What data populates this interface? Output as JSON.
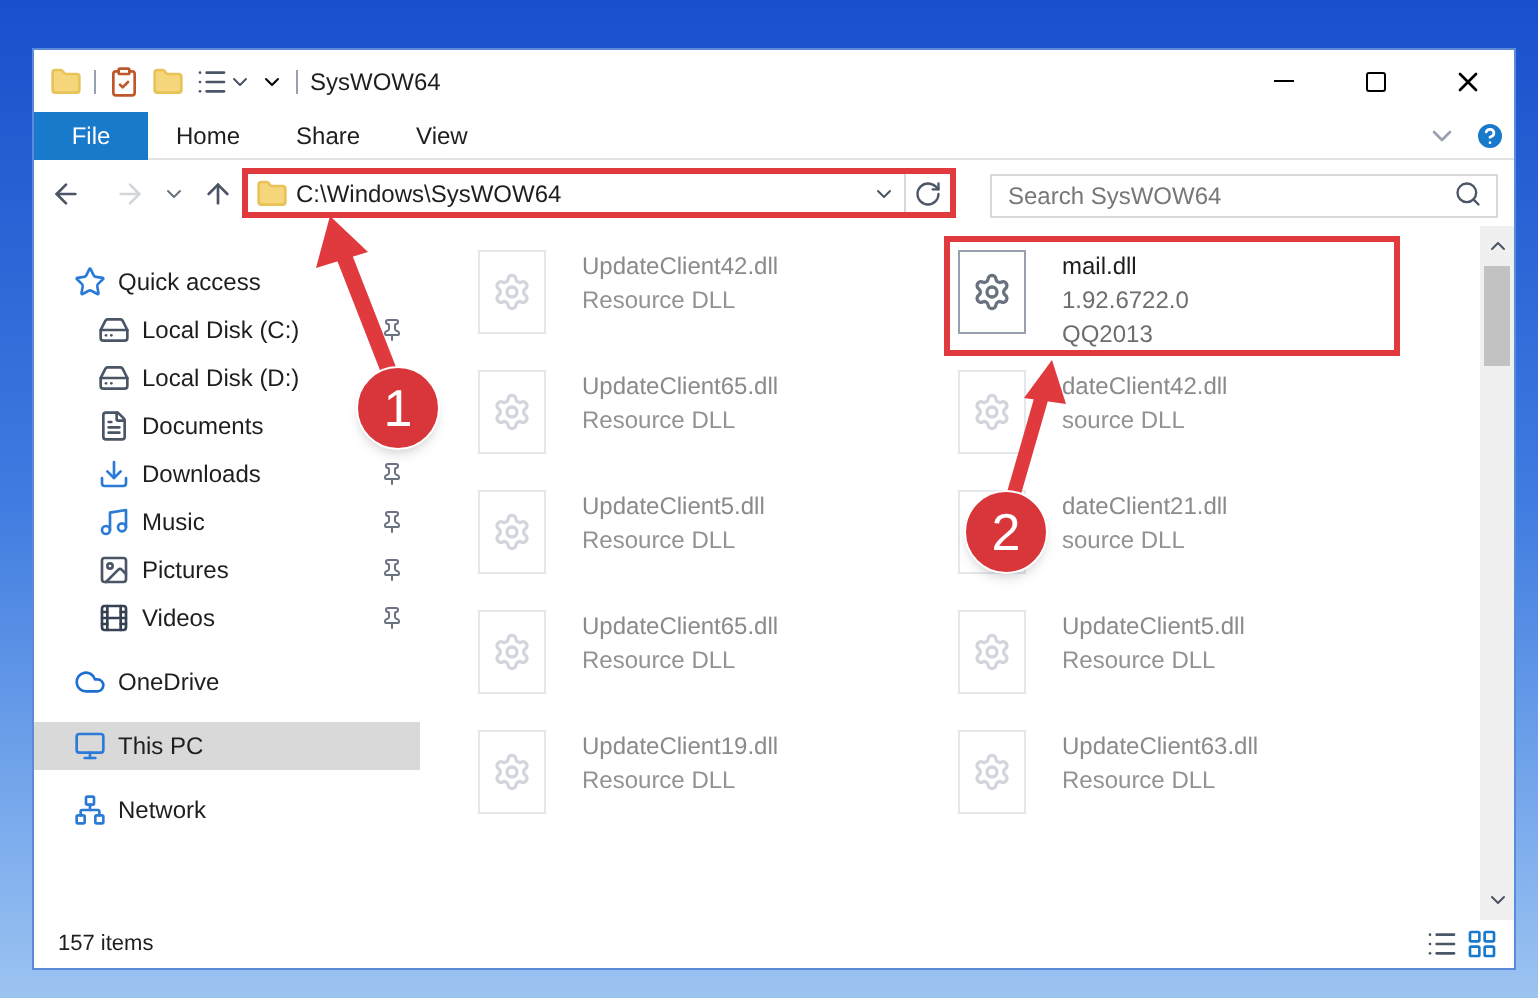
{
  "window": {
    "title": "SysWOW64"
  },
  "ribbon_tabs": [
    {
      "label": "File",
      "kind": "file"
    },
    {
      "label": "Home",
      "kind": "tab"
    },
    {
      "label": "Share",
      "kind": "tab"
    },
    {
      "label": "View",
      "kind": "tab"
    }
  ],
  "address": {
    "path": "C:\\Windows\\SysWOW64",
    "highlighted": true
  },
  "search": {
    "placeholder": "Search SysWOW64"
  },
  "sidebar": {
    "items": [
      {
        "label": "Quick access",
        "kind": "star",
        "selected": false,
        "children": [
          {
            "label": "Local Disk (C:)",
            "kind": "disk",
            "pinned": true,
            "selected": false
          },
          {
            "label": "Local Disk (D:)",
            "kind": "disk",
            "pinned": false,
            "selected": false
          },
          {
            "label": "Documents",
            "kind": "document",
            "pinned": false,
            "selected": false
          },
          {
            "label": "Downloads",
            "kind": "download",
            "pinned": true,
            "selected": false
          },
          {
            "label": "Music",
            "kind": "music",
            "pinned": true,
            "selected": false
          },
          {
            "label": "Pictures",
            "kind": "pictures",
            "pinned": true,
            "selected": false
          },
          {
            "label": "Videos",
            "kind": "videos",
            "pinned": true,
            "selected": false
          }
        ]
      },
      {
        "label": "OneDrive",
        "kind": "cloud",
        "selected": false
      },
      {
        "label": "This PC",
        "kind": "pc",
        "selected": true
      },
      {
        "label": "Network",
        "kind": "network",
        "selected": false
      }
    ]
  },
  "files": [
    {
      "name": "UpdateClient42.dll",
      "details": [
        "Resource DLL"
      ],
      "blurred": true,
      "highlighted": false
    },
    {
      "name": "mail.dll",
      "details": [
        "1.92.6722.0",
        "QQ2013"
      ],
      "blurred": false,
      "highlighted": true
    },
    {
      "name": "UpdateClient65.dll",
      "details": [
        "Resource DLL"
      ],
      "blurred": true,
      "highlighted": false
    },
    {
      "name": "dateClient42.dll",
      "details": [
        "source DLL"
      ],
      "blurred": true,
      "highlighted": false
    },
    {
      "name": "UpdateClient5.dll",
      "details": [
        "Resource DLL"
      ],
      "blurred": true,
      "highlighted": false
    },
    {
      "name": "dateClient21.dll",
      "details": [
        "source DLL"
      ],
      "blurred": true,
      "highlighted": false
    },
    {
      "name": "UpdateClient65.dll",
      "details": [
        "Resource DLL"
      ],
      "blurred": true,
      "highlighted": false
    },
    {
      "name": "UpdateClient5.dll",
      "details": [
        "Resource DLL"
      ],
      "blurred": true,
      "highlighted": false
    },
    {
      "name": "UpdateClient19.dll",
      "details": [
        "Resource DLL"
      ],
      "blurred": true,
      "highlighted": false
    },
    {
      "name": "UpdateClient63.dll",
      "details": [
        "Resource DLL"
      ],
      "blurred": true,
      "highlighted": false
    }
  ],
  "status_bar": {
    "item_count": "157 items"
  },
  "annotations": [
    {
      "label": "1"
    },
    {
      "label": "2"
    }
  ]
}
